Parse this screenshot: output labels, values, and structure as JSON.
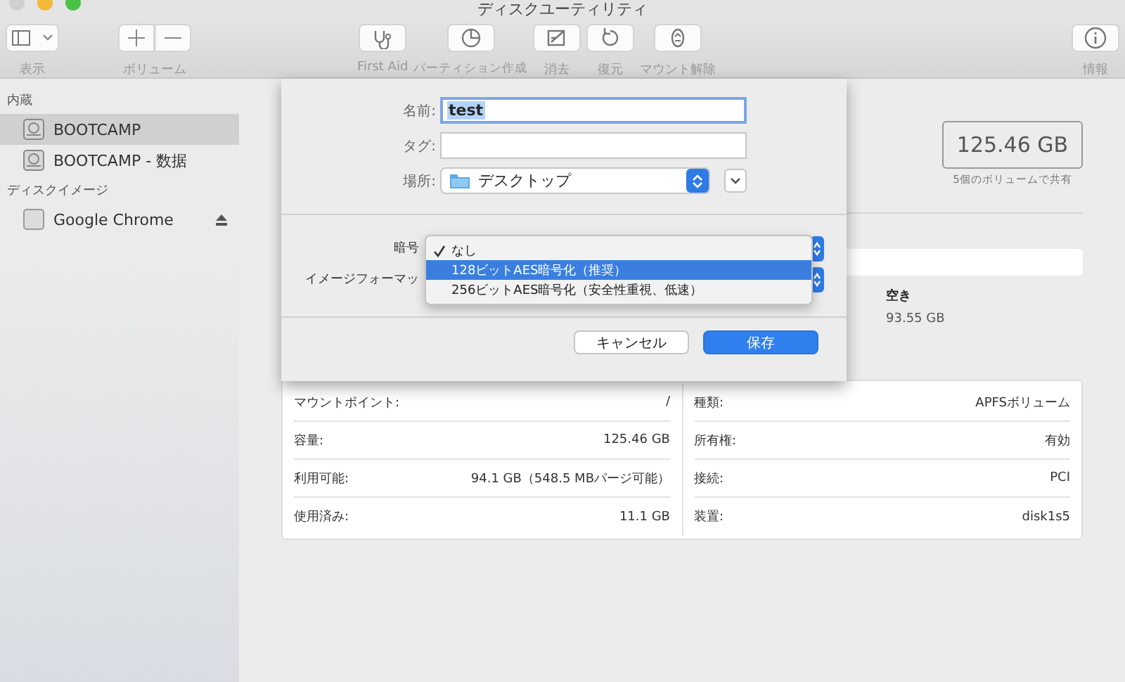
{
  "window": {
    "title": "ディスクユーティリティ"
  },
  "toolbar": {
    "left": [
      {
        "label": "表示",
        "kind": "view"
      },
      {
        "label": "ボリューム",
        "kind": "volume"
      }
    ],
    "center": [
      {
        "label": "First Aid",
        "kind": "firstaid"
      },
      {
        "label": "パーティション作成",
        "kind": "partition"
      },
      {
        "label": "消去",
        "kind": "erase"
      },
      {
        "label": "復元",
        "kind": "restore"
      },
      {
        "label": "マウント解除",
        "kind": "unmount"
      }
    ],
    "right": [
      {
        "label": "情報",
        "kind": "info"
      }
    ]
  },
  "sidebar": {
    "sections": [
      {
        "title": "内蔵",
        "items": [
          {
            "label": "BOOTCAMP",
            "selected": true,
            "ejectable": false
          },
          {
            "label": "BOOTCAMP - 数据",
            "selected": false,
            "ejectable": false
          }
        ]
      },
      {
        "title": "ディスクイメージ",
        "items": [
          {
            "label": "Google Chrome",
            "selected": false,
            "ejectable": true
          }
        ]
      }
    ]
  },
  "volume": {
    "capacity": "125.46 GB",
    "capacity_note": "5個のボリュームで共有",
    "free_label": "空き",
    "free_value": "93.55 GB"
  },
  "info": {
    "left": [
      {
        "label": "マウントポイント:",
        "value": "/"
      },
      {
        "label": "容量:",
        "value": "125.46 GB"
      },
      {
        "label": "利用可能:",
        "value": "94.1 GB（548.5 MBパージ可能）"
      },
      {
        "label": "使用済み:",
        "value": "11.1 GB"
      }
    ],
    "right": [
      {
        "label": "種類:",
        "value": "APFSボリューム"
      },
      {
        "label": "所有権:",
        "value": "有効"
      },
      {
        "label": "接続:",
        "value": "PCI"
      },
      {
        "label": "装置:",
        "value": "disk1s5"
      }
    ]
  },
  "sheet": {
    "name_label": "名前:",
    "name_value": "test",
    "name_text_selected": true,
    "tag_label": "タグ:",
    "location_label": "場所:",
    "location_value": "デスクトップ",
    "encryption_label": "暗号",
    "format_label": "イメージフォーマッ",
    "menu": [
      {
        "label": "なし",
        "checked": true,
        "selected": false
      },
      {
        "label": "128ビットAES暗号化（推奨）",
        "checked": false,
        "selected": true
      },
      {
        "label": "256ビットAES暗号化（安全性重視、低速）",
        "checked": false,
        "selected": false
      }
    ],
    "buttons": [
      {
        "label": "キャンセル",
        "kind": "secondary"
      },
      {
        "label": "保存",
        "kind": "primary"
      }
    ]
  }
}
